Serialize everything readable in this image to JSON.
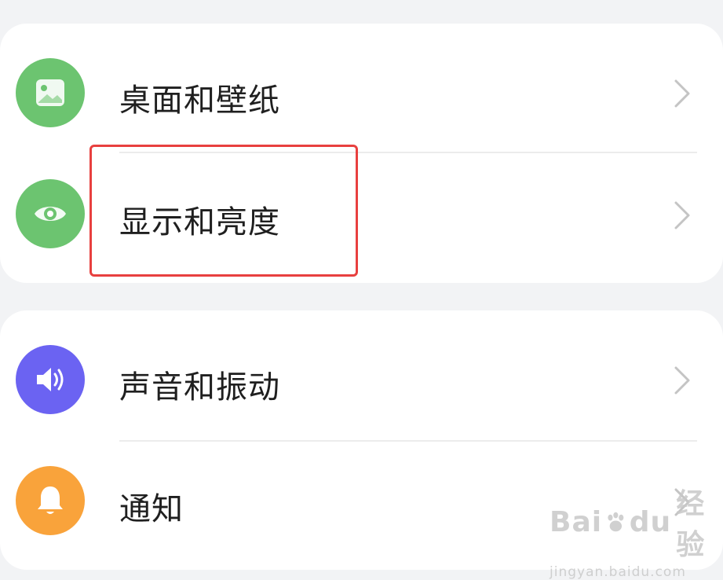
{
  "colors": {
    "wallpaper_icon_bg": "#6cc470",
    "display_icon_bg": "#6cc470",
    "sound_icon_bg": "#6b63f2",
    "notification_icon_bg": "#f9a33b",
    "highlight_border": "#e8403f"
  },
  "settings_group_1": {
    "items": [
      {
        "label": "桌面和壁纸",
        "icon": "image-icon"
      },
      {
        "label": "显示和亮度",
        "icon": "eye-icon"
      }
    ]
  },
  "settings_group_2": {
    "items": [
      {
        "label": "声音和振动",
        "icon": "speaker-icon"
      },
      {
        "label": "通知",
        "icon": "bell-icon"
      }
    ]
  },
  "watermark": {
    "brand_left": "Bai",
    "brand_right": "du",
    "brand_cn": "经验",
    "url": "jingyan.baidu.com"
  }
}
